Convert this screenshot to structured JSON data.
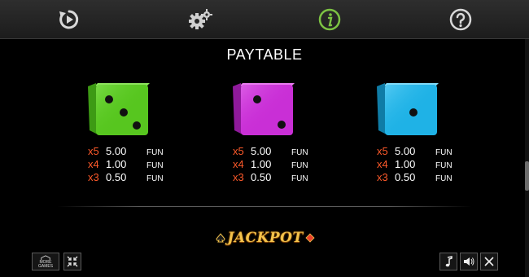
{
  "topbar": {
    "buttons": [
      {
        "icon": "replay-icon"
      },
      {
        "icon": "gear-icon"
      },
      {
        "icon": "info-icon",
        "active": true,
        "color": "#7cc243"
      },
      {
        "icon": "help-icon"
      }
    ]
  },
  "title": "PAYTABLE",
  "symbols": [
    {
      "name": "green-dice-three",
      "color": "#57c61f",
      "pips": 3,
      "payouts": [
        {
          "mult": "x5",
          "value": "5.00",
          "unit": "FUN"
        },
        {
          "mult": "x4",
          "value": "1.00",
          "unit": "FUN"
        },
        {
          "mult": "x3",
          "value": "0.50",
          "unit": "FUN"
        }
      ]
    },
    {
      "name": "magenta-dice-two",
      "color": "#c92fd6",
      "pips": 2,
      "payouts": [
        {
          "mult": "x5",
          "value": "5.00",
          "unit": "FUN"
        },
        {
          "mult": "x4",
          "value": "1.00",
          "unit": "FUN"
        },
        {
          "mult": "x3",
          "value": "0.50",
          "unit": "FUN"
        }
      ]
    },
    {
      "name": "cyan-dice-one",
      "color": "#1fb2e6",
      "pips": 1,
      "payouts": [
        {
          "mult": "x5",
          "value": "5.00",
          "unit": "FUN"
        },
        {
          "mult": "x4",
          "value": "1.00",
          "unit": "FUN"
        },
        {
          "mult": "x3",
          "value": "0.50",
          "unit": "FUN"
        }
      ]
    }
  ],
  "jackpot": {
    "label": "JACKPOT"
  },
  "bottombar": {
    "more_games_label": "MORE GAMES",
    "left_buttons": [
      {
        "icon": "home-icon"
      },
      {
        "icon": "fullscreen-icon"
      }
    ],
    "right_buttons": [
      {
        "icon": "music-icon"
      },
      {
        "icon": "sound-icon"
      },
      {
        "icon": "close-icon"
      }
    ]
  }
}
